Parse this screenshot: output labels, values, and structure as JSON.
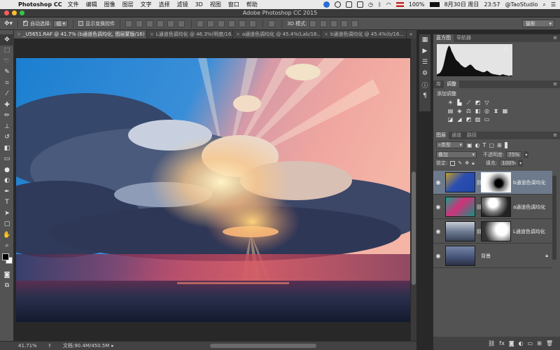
{
  "menubar": {
    "app_name": "Photoshop CC",
    "items": [
      "文件",
      "编辑",
      "图像",
      "图层",
      "文字",
      "选择",
      "滤镜",
      "3D",
      "视图",
      "窗口",
      "帮助"
    ],
    "battery": "100%",
    "date": "8月30日 周日",
    "time": "23:57",
    "user": "@TaoStudio"
  },
  "window": {
    "title": "Adobe Photoshop CC 2015"
  },
  "options_bar": {
    "auto_select_label": "自动选择:",
    "auto_select_checked": true,
    "auto_select_target": "组",
    "show_transform_label": "显示变换控件",
    "show_transform_checked": false,
    "mode_3d_label": "3D 模式:",
    "workspace": "摄影"
  },
  "tools": [
    {
      "icon": "move-icon",
      "glyph": "✥"
    },
    {
      "icon": "marquee-icon",
      "glyph": "⬚"
    },
    {
      "icon": "lasso-icon",
      "glyph": "➰"
    },
    {
      "icon": "quick-select-icon",
      "glyph": "✎"
    },
    {
      "icon": "crop-icon",
      "glyph": "⌗"
    },
    {
      "icon": "eyedropper-icon",
      "glyph": "⁄"
    },
    {
      "icon": "healing-brush-icon",
      "glyph": "✚"
    },
    {
      "icon": "brush-icon",
      "glyph": "✏"
    },
    {
      "icon": "clone-stamp-icon",
      "glyph": "⊥"
    },
    {
      "icon": "history-brush-icon",
      "glyph": "↺"
    },
    {
      "icon": "eraser-icon",
      "glyph": "◧"
    },
    {
      "icon": "gradient-icon",
      "glyph": "▭"
    },
    {
      "icon": "blur-icon",
      "glyph": "●"
    },
    {
      "icon": "dodge-icon",
      "glyph": "◐"
    },
    {
      "icon": "pen-icon",
      "glyph": "✒"
    },
    {
      "icon": "type-icon",
      "glyph": "T"
    },
    {
      "icon": "path-select-icon",
      "glyph": "➤"
    },
    {
      "icon": "rectangle-shape-icon",
      "glyph": "▢"
    },
    {
      "icon": "hand-icon",
      "glyph": "✋"
    },
    {
      "icon": "zoom-icon",
      "glyph": "⌕"
    }
  ],
  "tabs": [
    {
      "label": "_U5651.RAF @ 41.7% (b通道色调均化, 图层蒙版/16) *",
      "active": true
    },
    {
      "label": "L通道色调均化 @ 46.3%(明度/16...",
      "active": false
    },
    {
      "label": "a通道色调均化 @ 45.4%(Lab/16...",
      "active": false
    },
    {
      "label": "b通道色调均化 @ 45.4%(b/16...",
      "active": false
    }
  ],
  "status": {
    "zoom": "41.71%",
    "doc_info": "文档:90.4M/450.5M"
  },
  "histogram": {
    "tabs": [
      "直方图",
      "导航器"
    ],
    "values": [
      3,
      5,
      6,
      9,
      14,
      22,
      34,
      46,
      55,
      60,
      57,
      49,
      44,
      38,
      33,
      30,
      28,
      25,
      22,
      20,
      18,
      17,
      18,
      20,
      22,
      23,
      21,
      18,
      15,
      13,
      12,
      11,
      10,
      9,
      8,
      8,
      9,
      11,
      10,
      8,
      6,
      5,
      4,
      4,
      3,
      3,
      2,
      2,
      3,
      4,
      3,
      2,
      2,
      1,
      1,
      2,
      1
    ]
  },
  "adjustments": {
    "tabs": [
      "库",
      "调整"
    ],
    "label": "添加调整"
  },
  "layers": {
    "tabs": [
      "图层",
      "通道",
      "路径"
    ],
    "kind": "类型",
    "blend_mode": "叠加",
    "opacity_label": "不透明度:",
    "opacity": "75%",
    "lock_label": "锁定:",
    "fill_label": "填充:",
    "fill": "100%",
    "items": [
      {
        "name": "b通道色调均化",
        "active": true,
        "thumb_color": "#2b4fa8",
        "has_mask": true
      },
      {
        "name": "a通道色调均化",
        "active": false,
        "thumb_color": "#1e8a7d",
        "has_mask": true
      },
      {
        "name": "L通道色调均化",
        "active": false,
        "thumb_color": "#5c6a80",
        "has_mask": true
      },
      {
        "name": "背景",
        "active": false,
        "thumb_color": "#42506a",
        "has_mask": false,
        "locked": true
      }
    ]
  }
}
